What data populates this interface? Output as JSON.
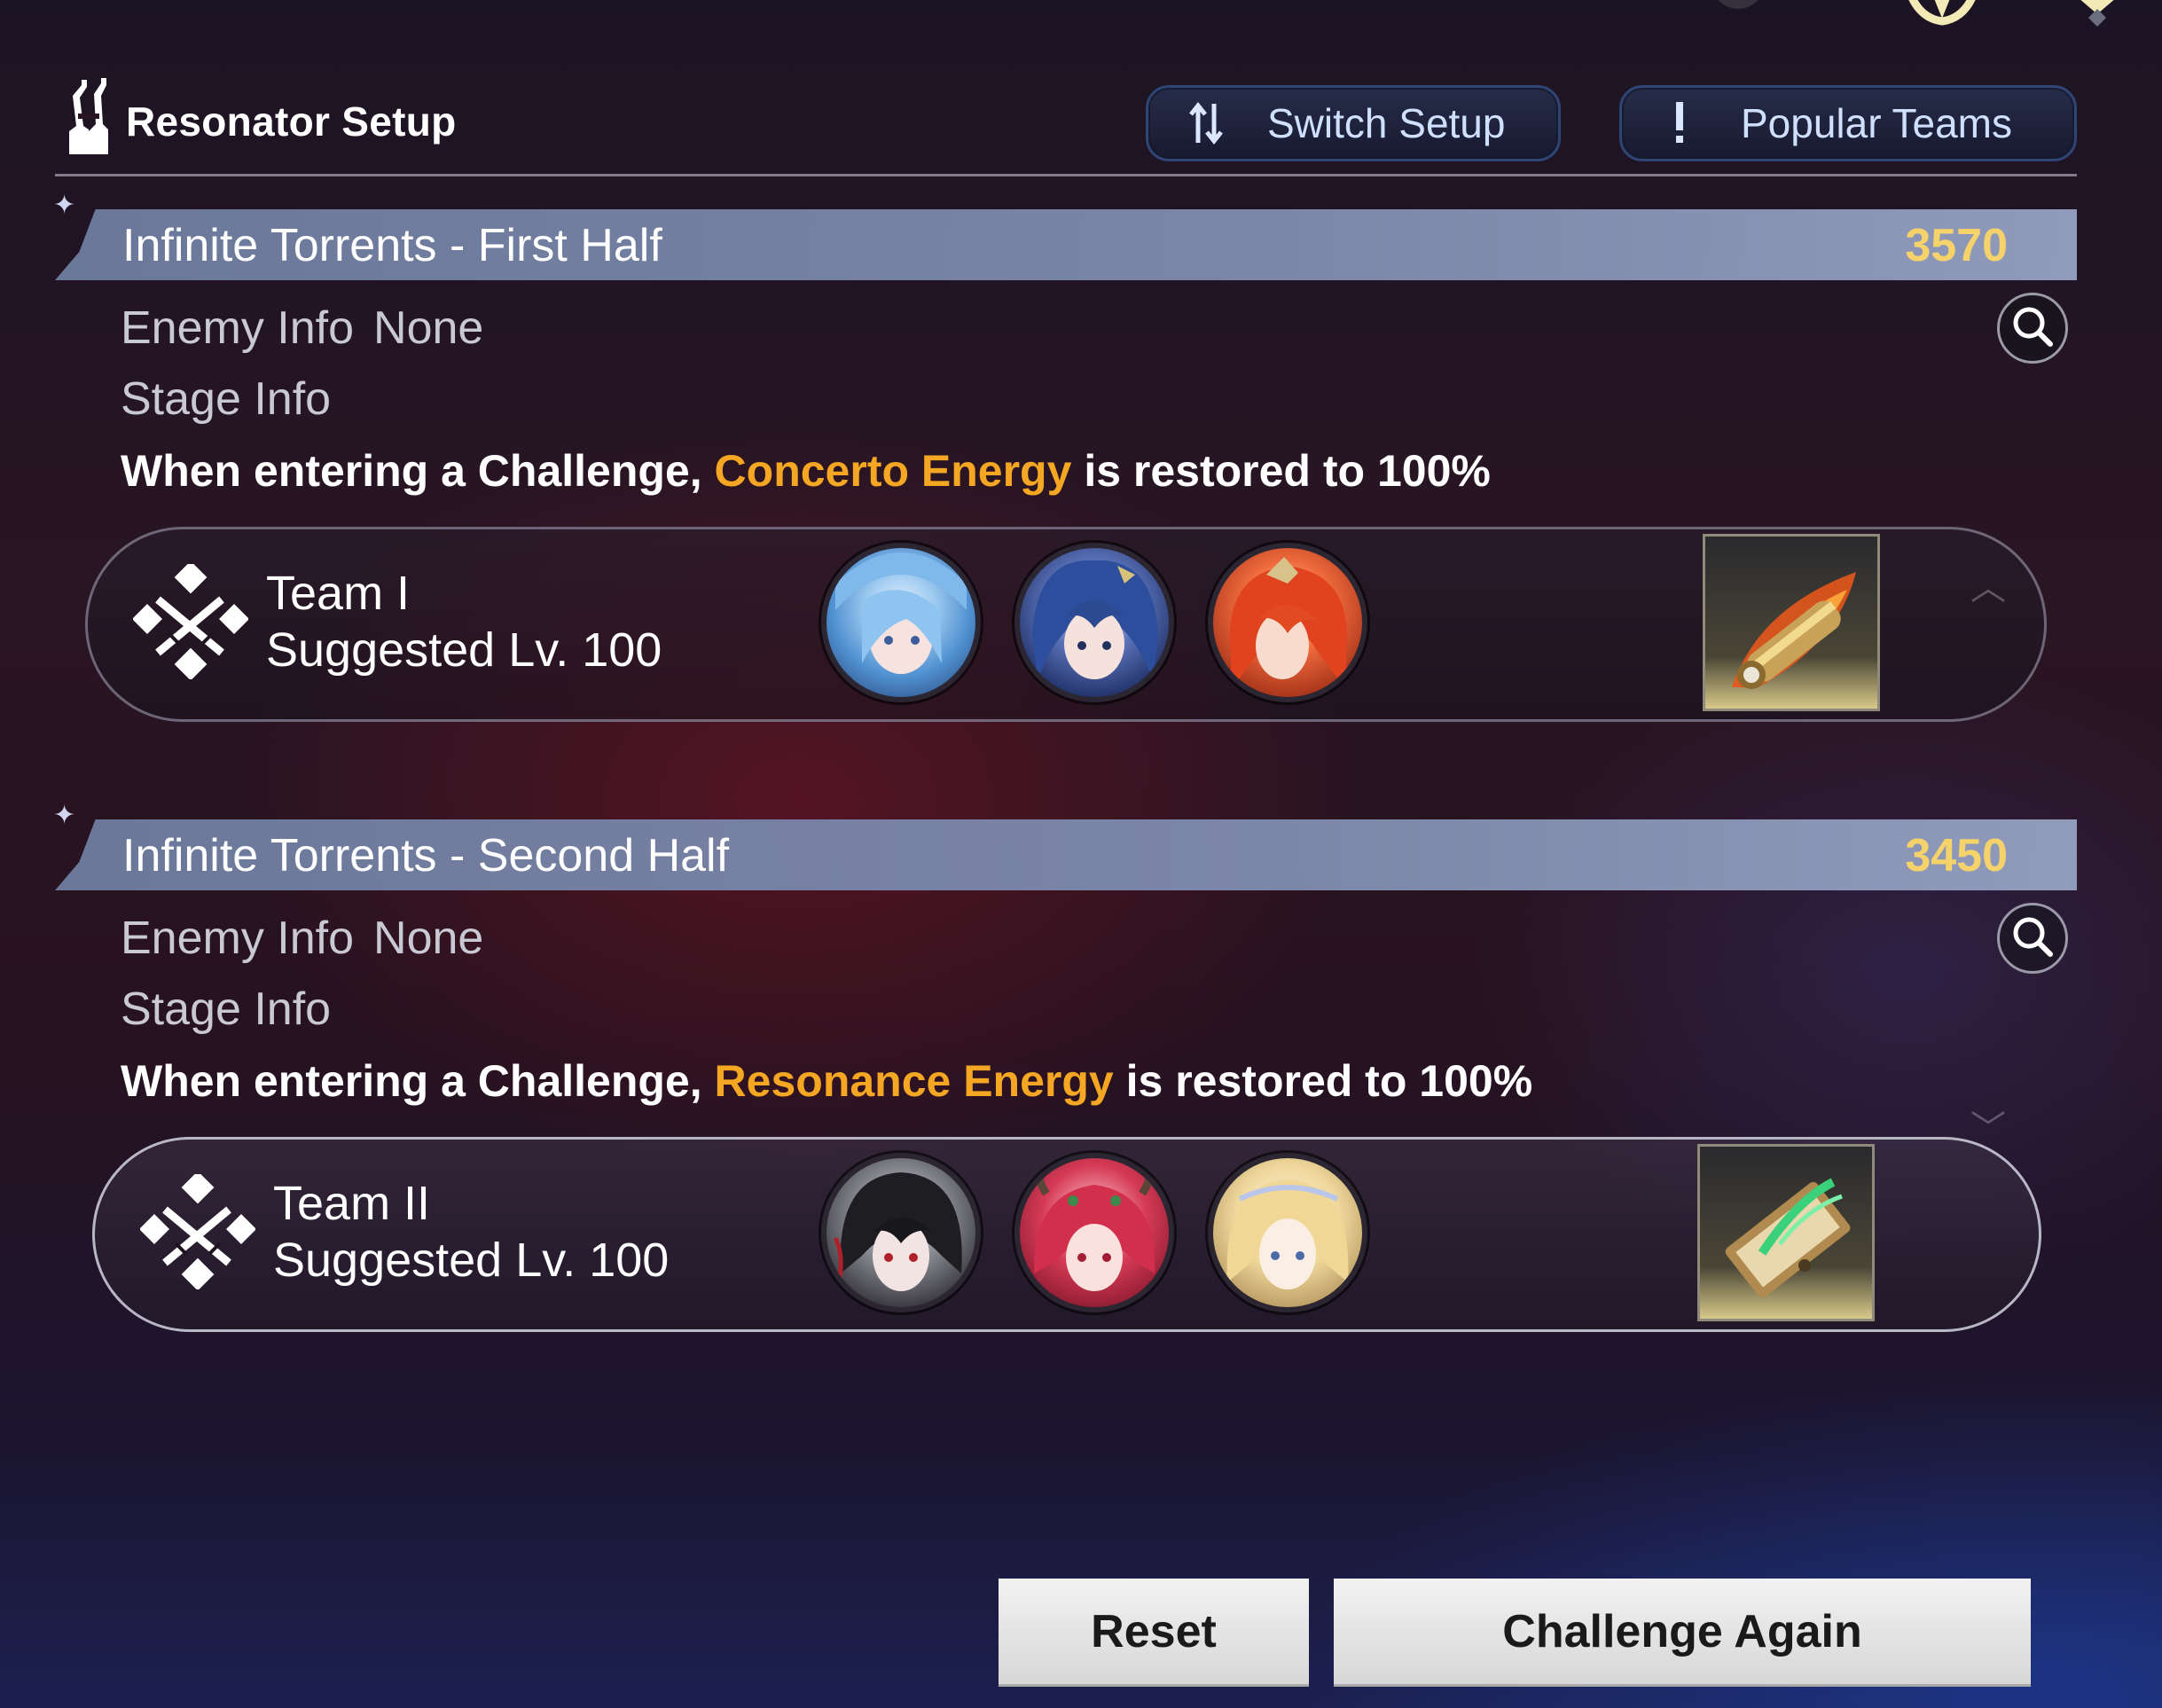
{
  "header": {
    "title": "Resonator Setup",
    "switch_label": "Switch Setup",
    "popular_label": "Popular Teams"
  },
  "stages": [
    {
      "title": "Infinite Torrents - First Half",
      "score": "3570",
      "enemy_label": "Enemy Info",
      "enemy_value": "None",
      "stage_label": "Stage Info",
      "desc_prefix": "When entering a Challenge,",
      "desc_highlight": "Concerto Energy",
      "desc_suffix": "is restored to 100%",
      "team": {
        "name": "Team I",
        "level": "Suggested Lv. 100"
      }
    },
    {
      "title": "Infinite Torrents - Second Half",
      "score": "3450",
      "enemy_label": "Enemy Info",
      "enemy_value": "None",
      "stage_label": "Stage Info",
      "desc_prefix": "When entering a Challenge,",
      "desc_highlight": "Resonance Energy",
      "desc_suffix": "is restored to 100%",
      "team": {
        "name": "Team II",
        "level": "Suggested Lv. 100"
      }
    }
  ],
  "buttons": {
    "reset": "Reset",
    "challenge_again": "Challenge Again"
  },
  "colors": {
    "highlight": "#f5a623",
    "score": "#f5d36a",
    "banner": "#8a96b8"
  },
  "icons": [
    "resonator-icon",
    "switch-icon",
    "alert-icon",
    "search-icon",
    "team-emblem-icon",
    "echo-item-icon",
    "chevron-up-icon",
    "chevron-down-icon"
  ]
}
